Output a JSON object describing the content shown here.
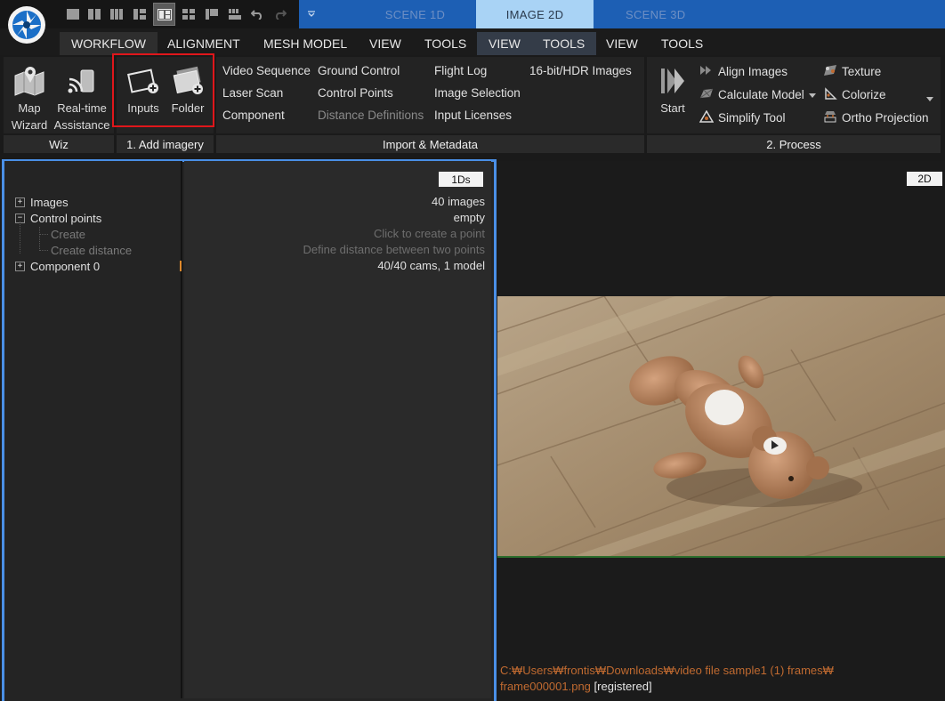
{
  "app": {
    "logo_icon": "aperture-logo-icon"
  },
  "quick_access": [
    {
      "name": "layout-1-icon"
    },
    {
      "name": "layout-2-icon"
    },
    {
      "name": "layout-3-icon"
    },
    {
      "name": "layout-4-icon"
    },
    {
      "name": "layout-5-icon",
      "active": true
    },
    {
      "name": "layout-6-icon"
    },
    {
      "name": "layout-7-icon"
    },
    {
      "name": "layout-8-icon"
    },
    {
      "name": "undo-icon"
    },
    {
      "name": "redo-icon"
    }
  ],
  "scene_tabs": {
    "scene1d": "SCENE 1D",
    "image2d": "IMAGE 2D",
    "scene3d": "SCENE 3D"
  },
  "menu": {
    "workflow": "WORKFLOW",
    "alignment": "ALIGNMENT",
    "mesh_model": "MESH MODEL",
    "view1": "VIEW",
    "tools1": "TOOLS",
    "view2": "VIEW",
    "tools2": "TOOLS",
    "view3": "VIEW",
    "tools3": "TOOLS"
  },
  "ribbon": {
    "wiz": {
      "map_wizard_1": "Map",
      "map_wizard_2": "Wizard",
      "realtime_1": "Real-time",
      "realtime_2": "Assistance",
      "footer": "Wiz"
    },
    "add_imagery": {
      "inputs": "Inputs",
      "folder": "Folder",
      "footer": "1. Add imagery"
    },
    "import": {
      "col1": [
        "Video Sequence",
        "Laser Scan",
        "Component"
      ],
      "col2": [
        "Ground Control",
        "Control Points",
        "Distance Definitions"
      ],
      "col3": [
        "Flight Log",
        "Image Selection",
        "Input Licenses"
      ],
      "col4": [
        "16-bit/HDR Images"
      ],
      "footer": "Import & Metadata"
    },
    "process": {
      "start": "Start",
      "align_images": "Align Images",
      "calculate_model": "Calculate Model",
      "simplify_tool": "Simplify Tool",
      "texture": "Texture",
      "colorize": "Colorize",
      "ortho_projection": "Ortho Projection",
      "footer": "2. Process"
    }
  },
  "left_panel": {
    "badge": "1Ds",
    "tree": [
      {
        "label": "Images",
        "value": "40 images"
      },
      {
        "label": "Control points",
        "value": "empty"
      },
      {
        "label": "Create",
        "value": "Click to create a point"
      },
      {
        "label": "Create distance",
        "value": "Define distance between two points"
      },
      {
        "label": "Component 0",
        "value": "40/40 cams, 1 model"
      }
    ]
  },
  "right_panel": {
    "badge": "2D",
    "path": "C:₩Users₩frontis₩Downloads₩video file sample1 (1) frames₩",
    "filename": "frame000001.png",
    "status": "[registered]"
  },
  "colors": {
    "accent_blue": "#4a8fe6",
    "highlight_red": "#e0161b",
    "tab_blue": "#1d5fb4",
    "tab_active": "#a9d3f5",
    "path_orange": "#c06a30"
  }
}
